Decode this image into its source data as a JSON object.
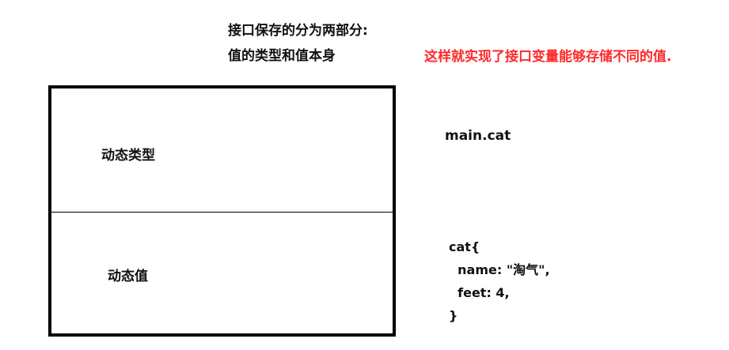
{
  "heading": {
    "line1": "接口保存的分为两部分:",
    "line2": "值的类型和值本身"
  },
  "note": {
    "text": "这样就实现了接口变量能够存储不同的值.",
    "color": "#ff2a2a"
  },
  "box": {
    "top_label": "动态类型",
    "bottom_label": "动态值"
  },
  "dynamic_type": {
    "text": "main.cat"
  },
  "dynamic_value": {
    "lines": [
      "cat{",
      "  name: \"淘气\",",
      "  feet: 4,",
      "}"
    ]
  }
}
